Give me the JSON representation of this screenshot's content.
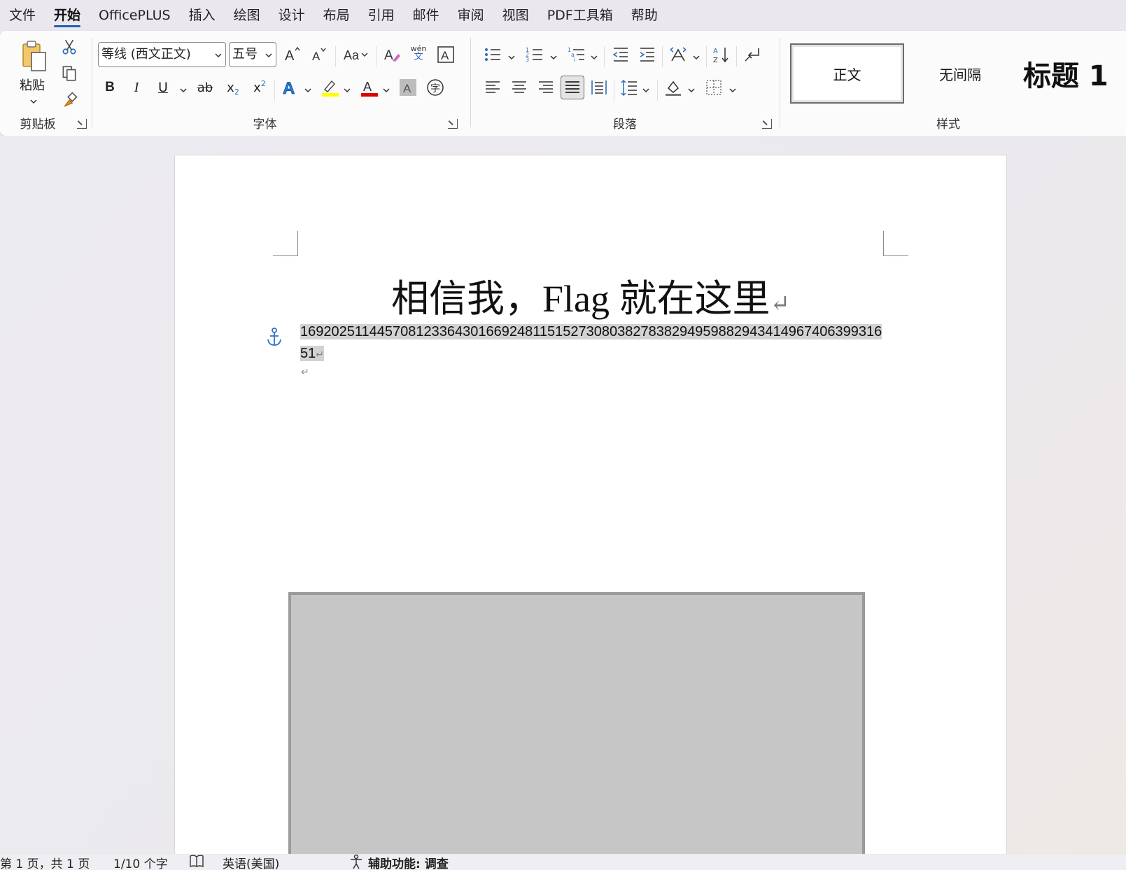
{
  "menu": {
    "tabs": [
      "文件",
      "开始",
      "OfficePLUS",
      "插入",
      "绘图",
      "设计",
      "布局",
      "引用",
      "邮件",
      "审阅",
      "视图",
      "PDF工具箱",
      "帮助"
    ],
    "active": "开始"
  },
  "clipboard": {
    "paste_label": "粘贴",
    "group_label": "剪贴板"
  },
  "font": {
    "font_name": "等线 (西文正文)",
    "font_size": "五号",
    "group_label": "字体",
    "bold": "B",
    "italic": "I",
    "underline": "U",
    "strike": "ab",
    "subscript": "x",
    "superscript": "x",
    "phonetic_top": "wén",
    "phonetic_bottom": "文",
    "highlight_color": "#ffff00",
    "font_color": "#e00000"
  },
  "paragraph": {
    "group_label": "段落"
  },
  "styles": {
    "group_label": "样式",
    "items": [
      "正文",
      "无间隔",
      "标题 1"
    ]
  },
  "document": {
    "title": "相信我，Flag 就在这里",
    "number_text": "16920251144570812336430166924811515273080382783829495988294341496740639931651"
  },
  "status": {
    "page": "第 1 页，共 1 页",
    "words": "1/10 个字",
    "language": "英语(美国)",
    "accessibility": "辅助功能: 调查"
  }
}
